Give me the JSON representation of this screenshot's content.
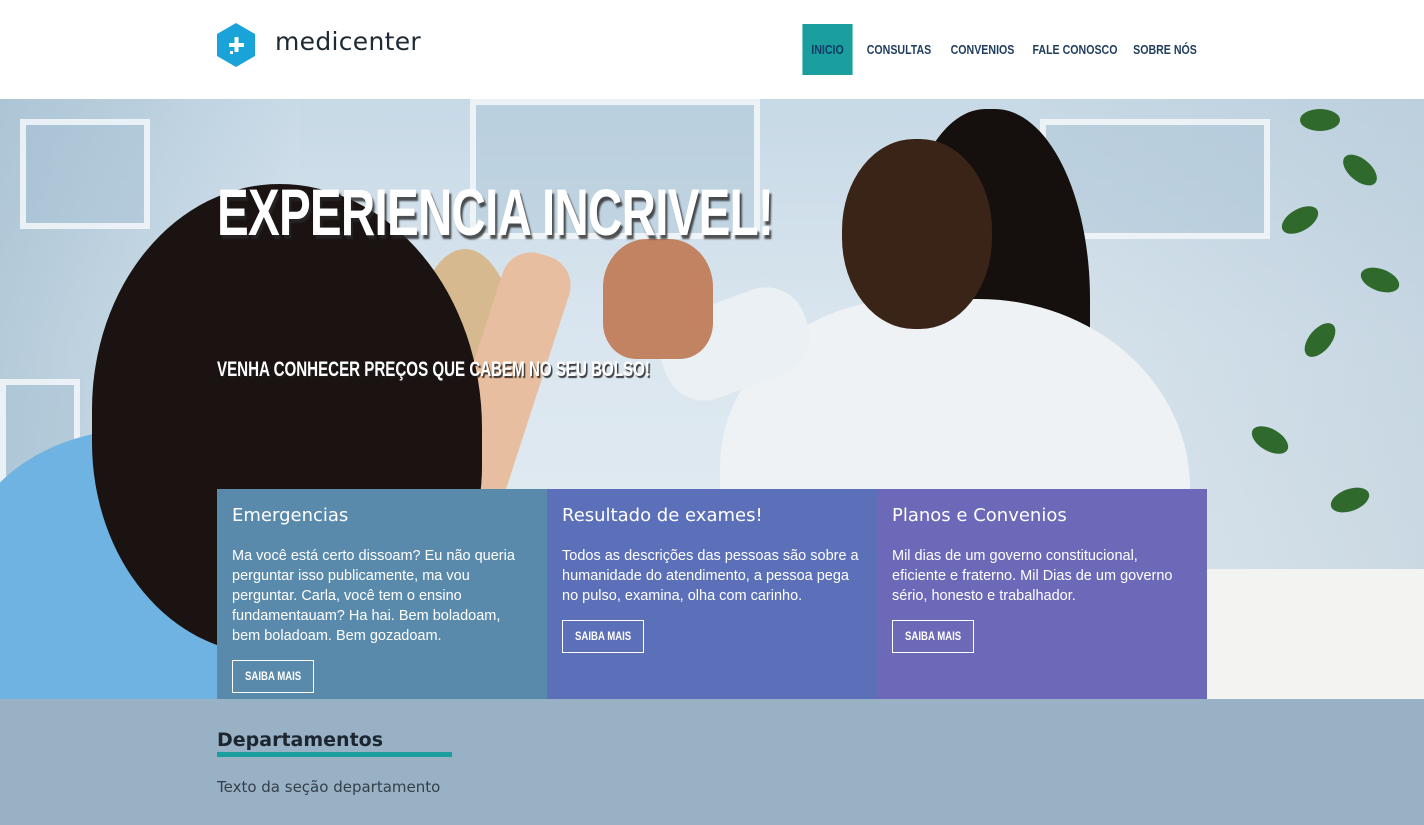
{
  "brand": {
    "name": "medicenter",
    "icon": "hexagon-plus-icon",
    "color": "#1aa3d9"
  },
  "nav": {
    "items": [
      {
        "label": "INICIO",
        "active": true
      },
      {
        "label": "CONSULTAS",
        "active": false
      },
      {
        "label": "CONVENIOS",
        "active": false
      },
      {
        "label": "FALE CONOSCO",
        "active": false
      },
      {
        "label": "SOBRE NÓS",
        "active": false
      }
    ],
    "active_color": "#1a9e9e"
  },
  "hero": {
    "title": "EXPERIENCIA INCRIVEL!",
    "subtitle": "VENHA CONHECER PREÇOS QUE CABEM NO SEU BOLSO!"
  },
  "cards": [
    {
      "title": "Emergencias",
      "text": "Ma você está certo dissoam? Eu não queria perguntar isso publicamente, ma vou perguntar. Carla, você tem o ensino fundamentauam? Ha hai. Bem boladoam, bem boladoam. Bem gozadoam.",
      "button": "SAIBA MAIS",
      "color": "#5a8aab"
    },
    {
      "title": "Resultado de exames!",
      "text": "Todos as descrições das pessoas são sobre a humanidade do atendimento, a pessoa pega no pulso, examina, olha com carinho.",
      "button": "SAIBA MAIS",
      "color": "#5b70b8"
    },
    {
      "title": "Planos e Convenios",
      "text": "Mil dias de um governo constitucional, eficiente e fraterno. Mil Dias de um governo sério, honesto e trabalhador.",
      "button": "SAIBA MAIS",
      "color": "#6b69b8"
    }
  ],
  "departments": {
    "title": "Departamentos",
    "text": "Texto da seção departamento"
  }
}
